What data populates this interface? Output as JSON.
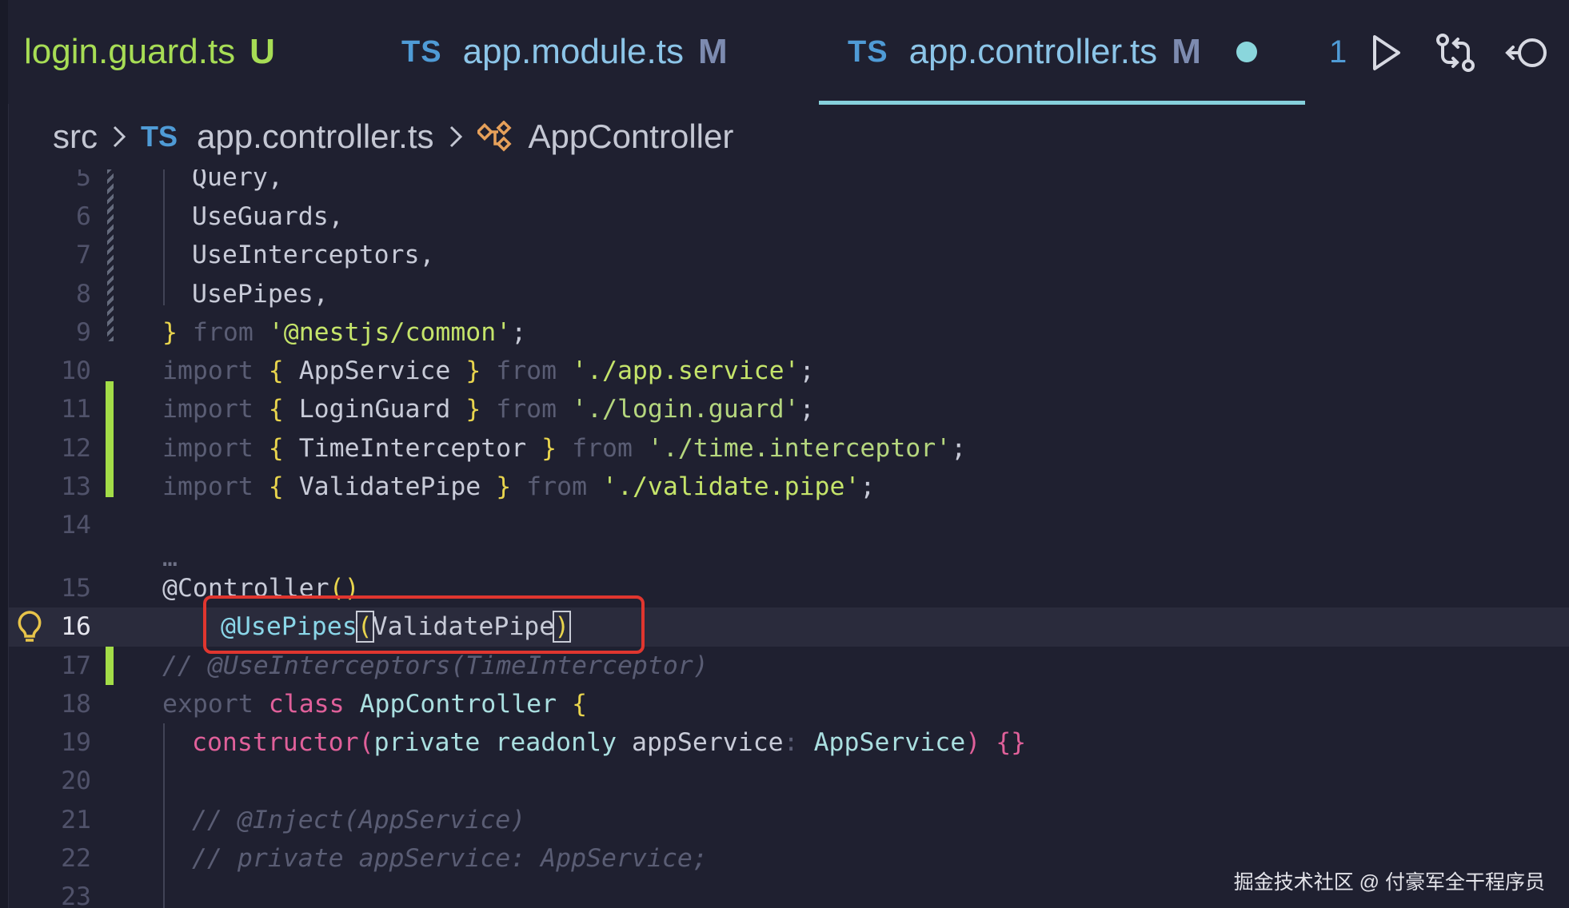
{
  "tabs": [
    {
      "name": "login.guard.ts",
      "badge": "U",
      "lang": ""
    },
    {
      "name": "app.module.ts",
      "badge": "M",
      "lang": "TS"
    },
    {
      "name": "app.controller.ts",
      "badge": "M",
      "lang": "TS",
      "active": true
    }
  ],
  "tab_overflow": "1",
  "breadcrumb": {
    "folder": "src",
    "lang": "TS",
    "file": "app.controller.ts",
    "symbol": "AppController"
  },
  "lines": [
    {
      "n": "5",
      "text": "Query,"
    },
    {
      "n": "6",
      "text": "UseGuards,"
    },
    {
      "n": "7",
      "text": "UseInterceptors,"
    },
    {
      "n": "8",
      "text": "UsePipes,"
    },
    {
      "n": "9",
      "t1": "}",
      "t2": " from ",
      "t3": "'@nestjs/common'",
      "t4": ";"
    },
    {
      "n": "10",
      "t1": "import ",
      "t2": "{",
      "t3": " AppService ",
      "t4": "}",
      "t5": " from ",
      "t6": "'./app.service'",
      "t7": ";"
    },
    {
      "n": "11",
      "t1": "import ",
      "t2": "{",
      "t3": " LoginGuard ",
      "t4": "}",
      "t5": " from ",
      "t6": "'./login.guard'",
      "t7": ";"
    },
    {
      "n": "12",
      "t1": "import ",
      "t2": "{",
      "t3": " TimeInterceptor ",
      "t4": "}",
      "t5": " from ",
      "t6": "'./time.interceptor'",
      "t7": ";"
    },
    {
      "n": "13",
      "t1": "import ",
      "t2": "{",
      "t3": " ValidatePipe ",
      "t4": "}",
      "t5": " from ",
      "t6": "'./validate.pipe'",
      "t7": ";"
    },
    {
      "n": "14"
    },
    {
      "n": "",
      "text": "…"
    },
    {
      "n": "15",
      "t1": "@Controller",
      "t2": "()"
    },
    {
      "n": "16",
      "t1": "@UsePipes",
      "t2": "(",
      "t3": "ValidatePipe",
      "t4": ")"
    },
    {
      "n": "17",
      "text": "// @UseInterceptors(TimeInterceptor)"
    },
    {
      "n": "18",
      "t1": "export ",
      "t2": "class ",
      "t3": "AppController ",
      "t4": "{"
    },
    {
      "n": "19",
      "t1": "constructor",
      "t2": "(",
      "t3": "private readonly ",
      "t4": "appService",
      "t5": ": ",
      "t6": "AppService",
      "t7": ") ",
      "t8": "{}"
    },
    {
      "n": "20"
    },
    {
      "n": "21",
      "text": "// @Inject(AppService)"
    },
    {
      "n": "22",
      "text": "// private appService: AppService;"
    },
    {
      "n": "23"
    }
  ],
  "watermark": "掘金技术社区 @ 付豪军全干程序员",
  "colors": {
    "accent": "#86d0dc",
    "added": "#a3dd48",
    "highlight": "#e0362f",
    "ts": "#4f9bd6"
  }
}
